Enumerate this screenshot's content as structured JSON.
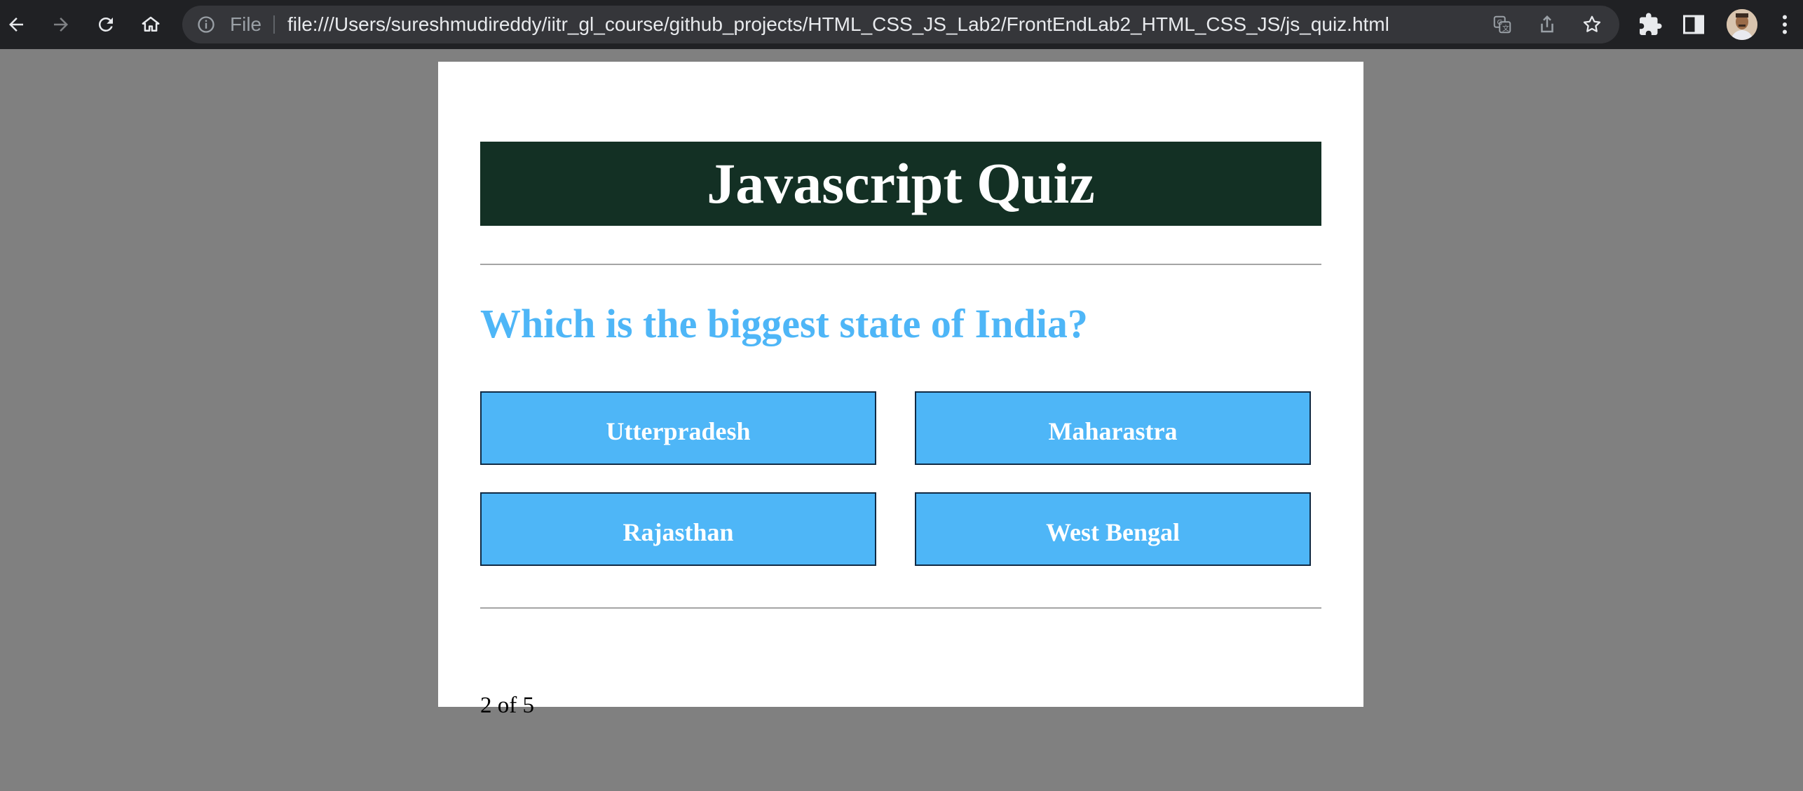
{
  "browser": {
    "scheme_label": "File",
    "url": "file:///Users/sureshmudireddy/iitr_gl_course/github_projects/HTML_CSS_JS_Lab2/FrontEndLab2_HTML_CSS_JS/js_quiz.html",
    "icons": {
      "back": "arrow-left-icon",
      "forward": "arrow-right-icon",
      "reload": "reload-icon",
      "home": "home-icon",
      "info": "info-icon",
      "translate": "translate-icon",
      "share": "share-icon",
      "bookmark": "star-icon",
      "extensions": "puzzle-icon",
      "side_panel": "side-panel-icon",
      "menu": "kebab-menu-icon"
    },
    "colors": {
      "toolbar": "#202124",
      "omnibox": "#35363a",
      "url": "#e8eaed"
    }
  },
  "quiz": {
    "title": "Javascript Quiz",
    "question": "Which is the biggest state of India?",
    "choices": [
      "Utterpradesh",
      "Maharastra",
      "Rajasthan",
      "West Bengal"
    ],
    "progress": "2 of 5",
    "colors": {
      "header_bg": "#133024",
      "accent": "#4eb6f7",
      "page_bg": "#808080"
    }
  }
}
